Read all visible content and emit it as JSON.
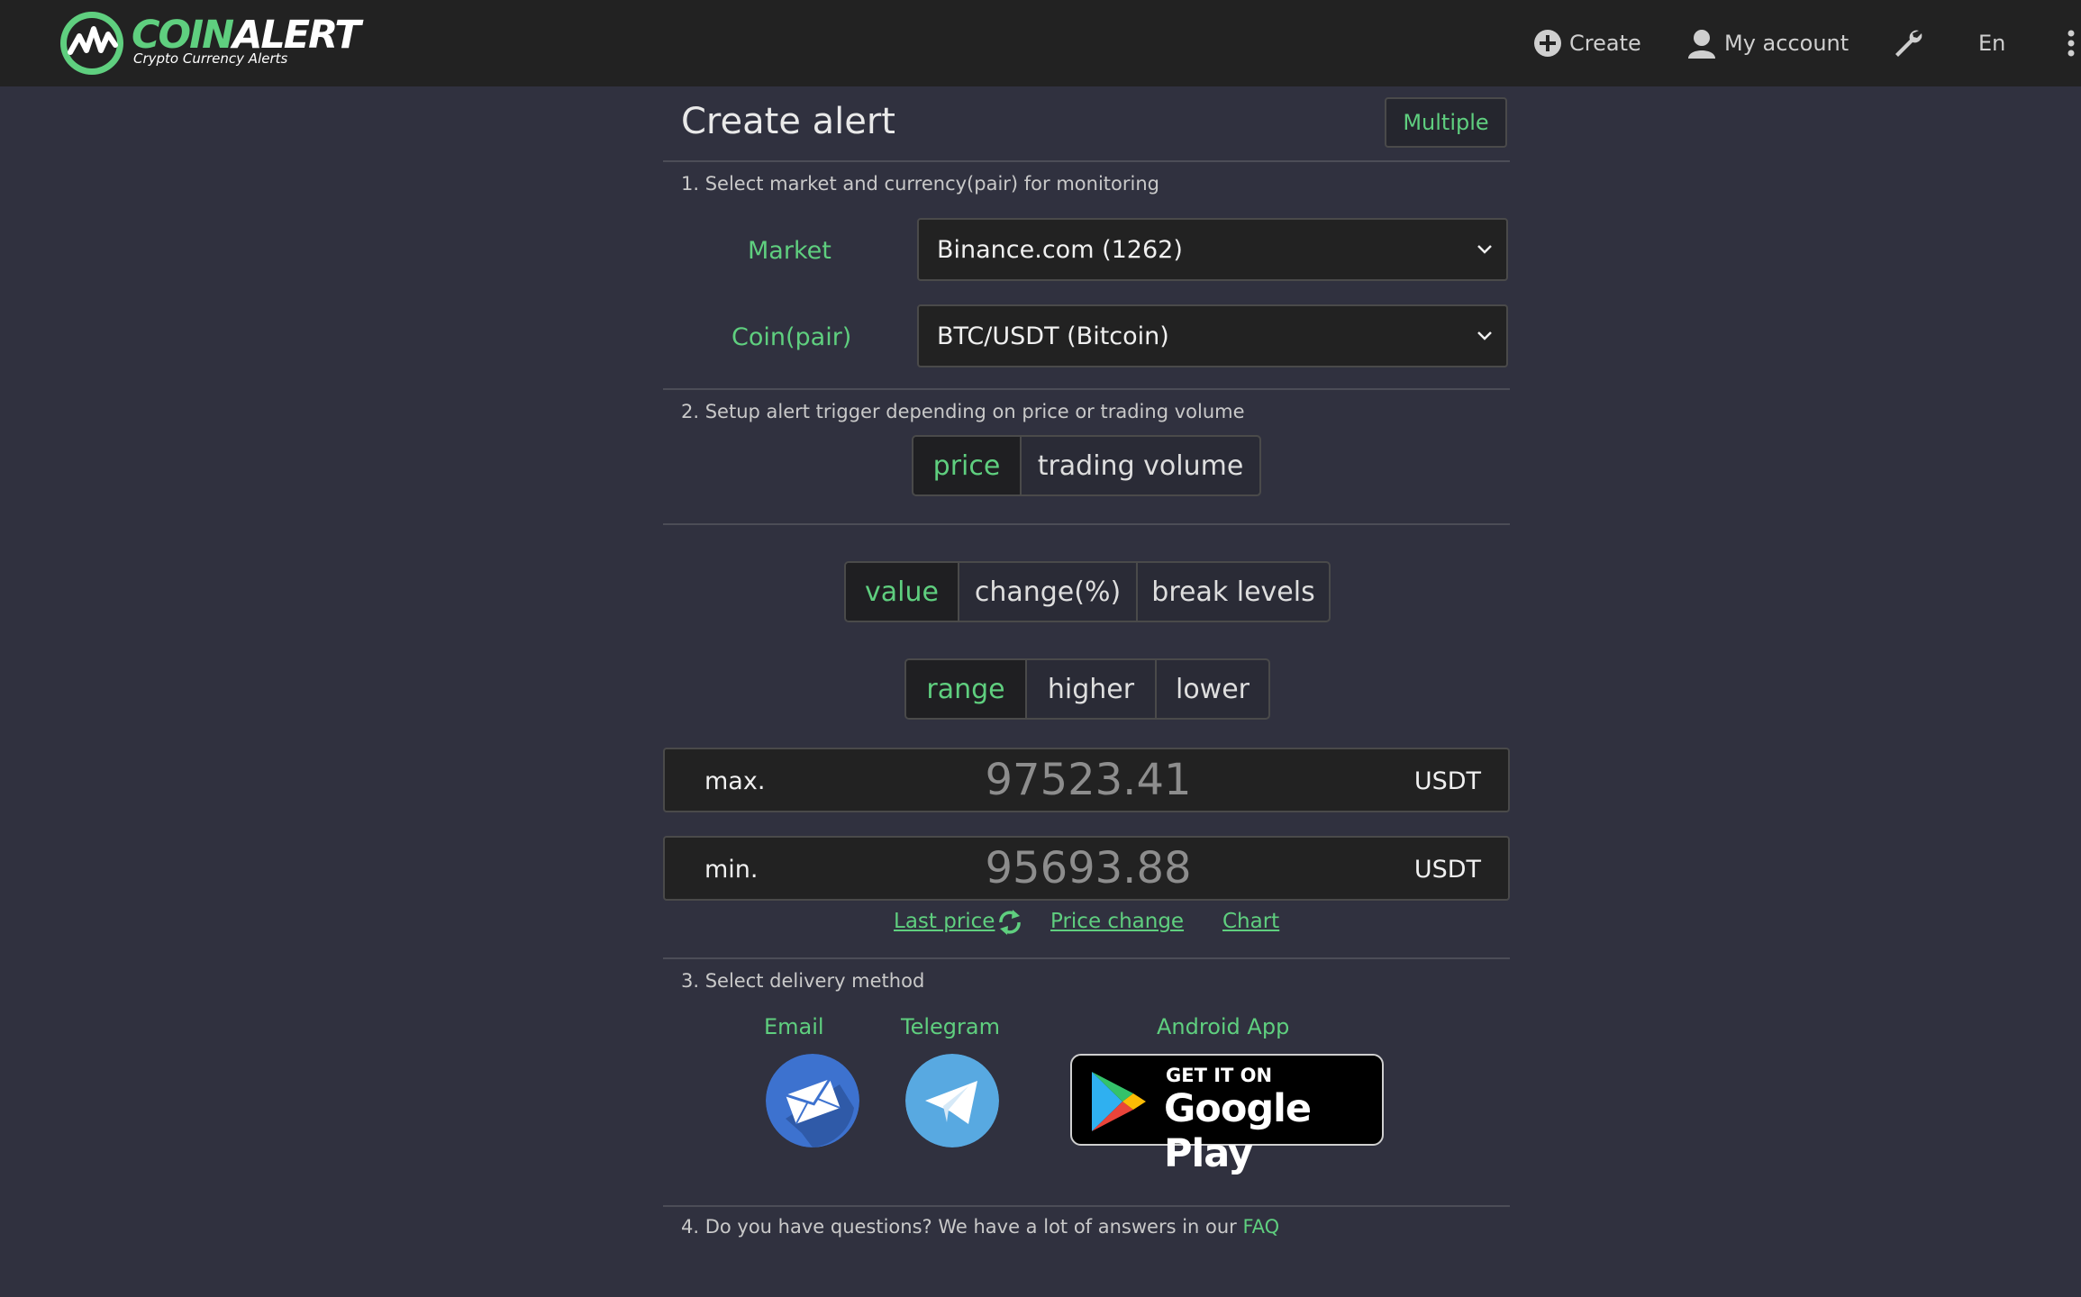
{
  "brand": {
    "name_part1": "COIN",
    "name_part2": "ALERT",
    "tagline": "Crypto Currency Alerts"
  },
  "nav": {
    "create": "Create",
    "account": "My account",
    "language": "En"
  },
  "page": {
    "title": "Create alert",
    "multiple_label": "Multiple"
  },
  "step1": {
    "label": "1. Select market and currency(pair) for monitoring",
    "market_label": "Market",
    "market_value": "Binance.com (1262)",
    "coin_label": "Coin(pair)",
    "coin_value": "BTC/USDT (Bitcoin)"
  },
  "step2": {
    "label": "2. Setup alert trigger depending on price or trading volume",
    "trigger_tabs": [
      "price",
      "trading volume"
    ],
    "trigger_active": "price",
    "mode_tabs": [
      "value",
      "change(%)",
      "break levels"
    ],
    "mode_active": "value",
    "direction_tabs": [
      "range",
      "higher",
      "lower"
    ],
    "direction_active": "range",
    "max": {
      "label": "max.",
      "placeholder": "97523.41",
      "unit": "USDT"
    },
    "min": {
      "label": "min.",
      "placeholder": "95693.88",
      "unit": "USDT"
    },
    "links": {
      "last_price": "Last price",
      "price_change": "Price change",
      "chart": "Chart"
    }
  },
  "step3": {
    "label": "3. Select delivery method",
    "email": "Email",
    "telegram": "Telegram",
    "android": "Android App",
    "gplay_small": "GET IT ON",
    "gplay_big": "Google Play"
  },
  "step4": {
    "text": "4. Do you have questions? We have a lot of answers in our",
    "link": "FAQ"
  },
  "colors": {
    "accent": "#5fcf7f",
    "background": "#30313f",
    "topbar": "#222222"
  }
}
